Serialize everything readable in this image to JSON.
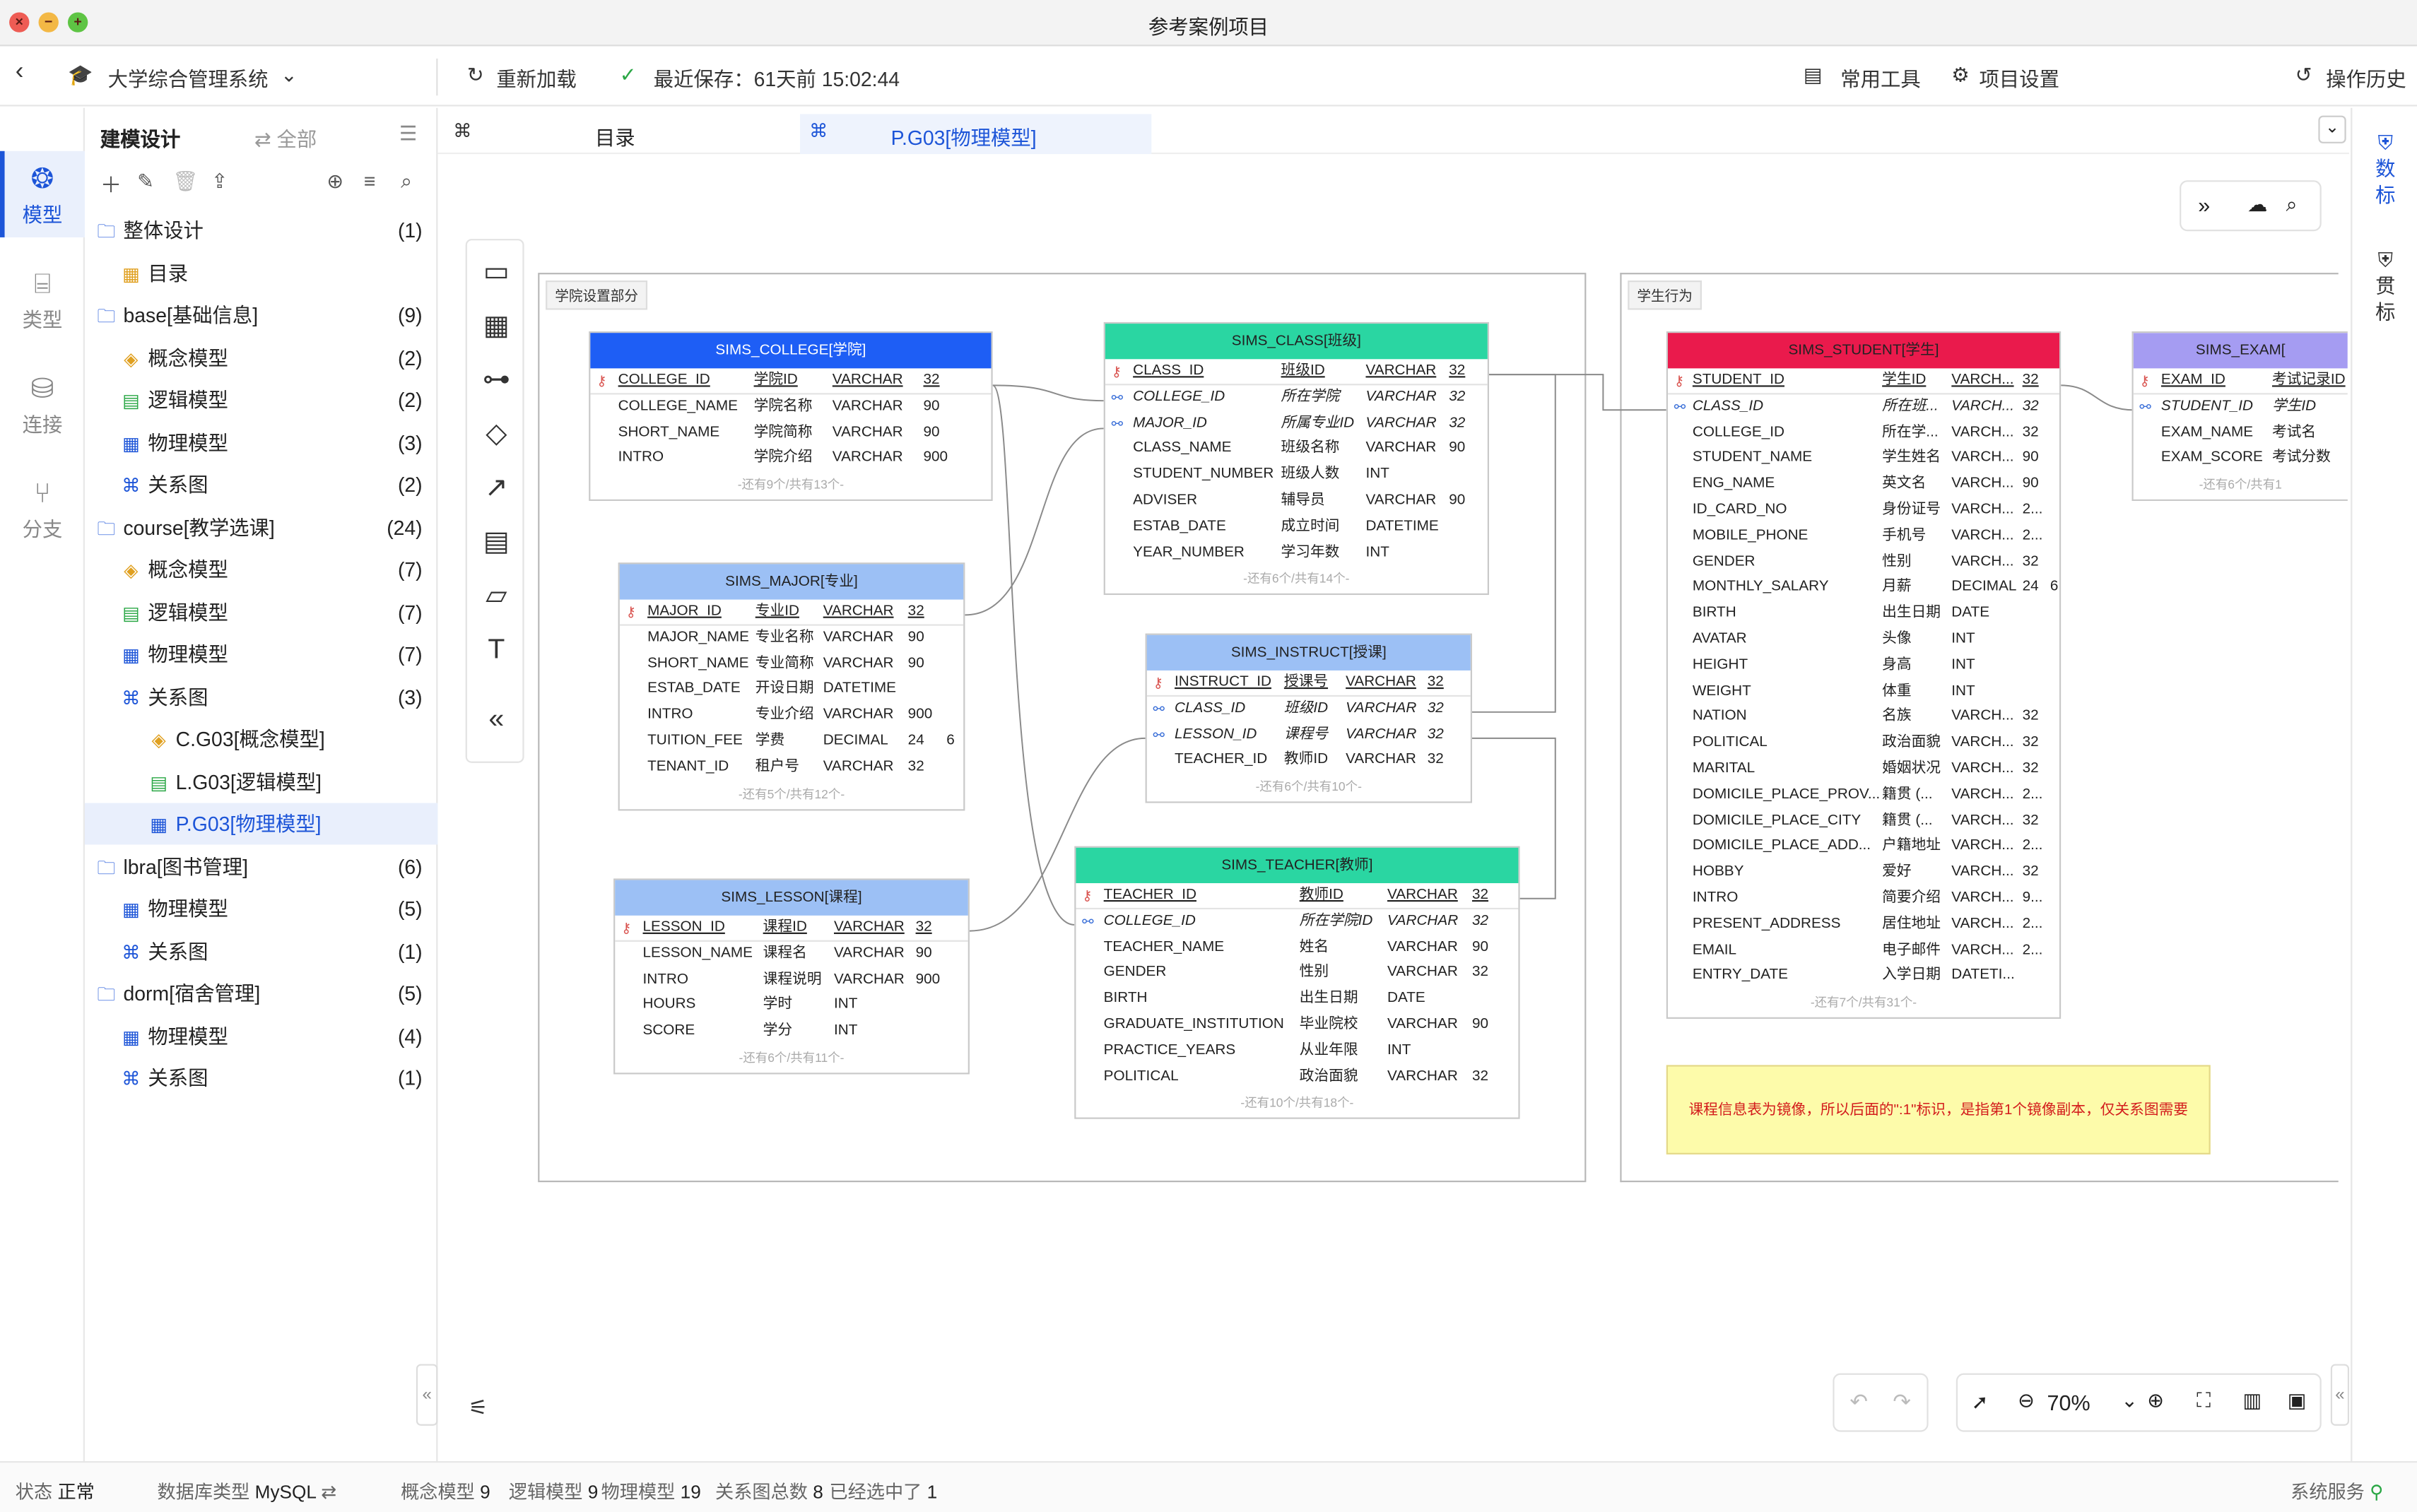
{
  "window": {
    "title": "参考案例项目"
  },
  "toolbar": {
    "project": "大学综合管理系统",
    "reload": "重新加载",
    "last_saved": "最近保存：61天前 15:02:44",
    "tools": "常用工具",
    "settings": "项目设置",
    "history": "操作历史"
  },
  "rail": [
    {
      "label": "模型",
      "icon": "model-icon"
    },
    {
      "label": "类型",
      "icon": "type-icon"
    },
    {
      "label": "连接",
      "icon": "connection-icon"
    },
    {
      "label": "分支",
      "icon": "branch-icon"
    }
  ],
  "tree_header": {
    "title": "建模设计",
    "filter": "全部"
  },
  "tree": [
    {
      "label": "整体设计",
      "count": "(1)",
      "level": 0,
      "icon": "folder-icon"
    },
    {
      "label": "目录",
      "count": "",
      "level": 1,
      "icon": "catalog-icon"
    },
    {
      "label": "base[基础信息]",
      "count": "(9)",
      "level": 0,
      "icon": "folder-icon"
    },
    {
      "label": "概念模型",
      "count": "(2)",
      "level": 1,
      "icon": "concept-model-icon"
    },
    {
      "label": "逻辑模型",
      "count": "(2)",
      "level": 1,
      "icon": "logic-model-icon"
    },
    {
      "label": "物理模型",
      "count": "(3)",
      "level": 1,
      "icon": "physical-model-icon"
    },
    {
      "label": "关系图",
      "count": "(2)",
      "level": 1,
      "icon": "diagram-icon"
    },
    {
      "label": "course[教学选课]",
      "count": "(24)",
      "level": 0,
      "icon": "folder-icon"
    },
    {
      "label": "概念模型",
      "count": "(7)",
      "level": 1,
      "icon": "concept-model-icon"
    },
    {
      "label": "逻辑模型",
      "count": "(7)",
      "level": 1,
      "icon": "logic-model-icon"
    },
    {
      "label": "物理模型",
      "count": "(7)",
      "level": 1,
      "icon": "physical-model-icon"
    },
    {
      "label": "关系图",
      "count": "(3)",
      "level": 1,
      "icon": "diagram-icon"
    },
    {
      "label": "C.G03[概念模型]",
      "count": "",
      "level": 2,
      "icon": "concept-model-icon"
    },
    {
      "label": "L.G03[逻辑模型]",
      "count": "",
      "level": 2,
      "icon": "logic-model-icon"
    },
    {
      "label": "P.G03[物理模型]",
      "count": "",
      "level": 2,
      "icon": "physical-model-icon",
      "selected": true
    },
    {
      "label": "lbra[图书管理]",
      "count": "(6)",
      "level": 0,
      "icon": "folder-icon"
    },
    {
      "label": "物理模型",
      "count": "(5)",
      "level": 1,
      "icon": "physical-model-icon"
    },
    {
      "label": "关系图",
      "count": "(1)",
      "level": 1,
      "icon": "diagram-icon"
    },
    {
      "label": "dorm[宿舍管理]",
      "count": "(5)",
      "level": 0,
      "icon": "folder-icon"
    },
    {
      "label": "物理模型",
      "count": "(4)",
      "level": 1,
      "icon": "physical-model-icon"
    },
    {
      "label": "关系图",
      "count": "(1)",
      "level": 1,
      "icon": "diagram-icon"
    }
  ],
  "tabs": [
    {
      "label": "目录"
    },
    {
      "label": "P.G03[物理模型]",
      "active": true
    }
  ],
  "groups": [
    {
      "title": "学院设置部分"
    },
    {
      "title": "学生行为"
    }
  ],
  "tables": [
    {
      "name": "SIMS_COLLEGE[学院]",
      "color": "#1e5ef5",
      "textColor": "#ffffff",
      "rows": [
        [
          "COLLEGE_ID",
          "学院ID",
          "VARCHAR",
          "32",
          "",
          "pk"
        ],
        [
          "COLLEGE_NAME",
          "学院名称",
          "VARCHAR",
          "90",
          "",
          ""
        ],
        [
          "SHORT_NAME",
          "学院简称",
          "VARCHAR",
          "90",
          "",
          ""
        ],
        [
          "INTRO",
          "学院介绍",
          "VARCHAR",
          "900",
          "",
          ""
        ]
      ],
      "more": "-还有9个/共有13个-"
    },
    {
      "name": "SIMS_CLASS[班级]",
      "color": "#2ad6a2",
      "textColor": "#222222",
      "rows": [
        [
          "CLASS_ID",
          "班级ID",
          "VARCHAR",
          "32",
          "",
          "pk"
        ],
        [
          "COLLEGE_ID",
          "所在学院",
          "VARCHAR",
          "32",
          "",
          "fk"
        ],
        [
          "MAJOR_ID",
          "所属专业ID",
          "VARCHAR",
          "32",
          "",
          "fk"
        ],
        [
          "CLASS_NAME",
          "班级名称",
          "VARCHAR",
          "90",
          "",
          ""
        ],
        [
          "STUDENT_NUMBER",
          "班级人数",
          "INT",
          "",
          "",
          ""
        ],
        [
          "ADVISER",
          "辅导员",
          "VARCHAR",
          "90",
          "",
          ""
        ],
        [
          "ESTAB_DATE",
          "成立时间",
          "DATETIME",
          "",
          "",
          ""
        ],
        [
          "YEAR_NUMBER",
          "学习年数",
          "INT",
          "",
          "",
          ""
        ]
      ],
      "more": "-还有6个/共有14个-"
    },
    {
      "name": "SIMS_MAJOR[专业]",
      "color": "#9cc0f5",
      "textColor": "#222222",
      "rows": [
        [
          "MAJOR_ID",
          "专业ID",
          "VARCHAR",
          "32",
          "",
          "pk"
        ],
        [
          "MAJOR_NAME",
          "专业名称",
          "VARCHAR",
          "90",
          "",
          ""
        ],
        [
          "SHORT_NAME",
          "专业简称",
          "VARCHAR",
          "90",
          "",
          ""
        ],
        [
          "ESTAB_DATE",
          "开设日期",
          "DATETIME",
          "",
          "",
          ""
        ],
        [
          "INTRO",
          "专业介绍",
          "VARCHAR",
          "900",
          "",
          ""
        ],
        [
          "TUITION_FEE",
          "学费",
          "DECIMAL",
          "24",
          "6",
          ""
        ],
        [
          "TENANT_ID",
          "租户号",
          "VARCHAR",
          "32",
          "",
          ""
        ]
      ],
      "more": "-还有5个/共有12个-"
    },
    {
      "name": "SIMS_INSTRUCT[授课]",
      "color": "#9cc0f5",
      "textColor": "#222222",
      "rows": [
        [
          "INSTRUCT_ID",
          "授课号",
          "VARCHAR",
          "32",
          "",
          "pk"
        ],
        [
          "CLASS_ID",
          "班级ID",
          "VARCHAR",
          "32",
          "",
          "fk"
        ],
        [
          "LESSON_ID",
          "课程号",
          "VARCHAR",
          "32",
          "",
          "fk"
        ],
        [
          "TEACHER_ID",
          "教师ID",
          "VARCHAR",
          "32",
          "",
          ""
        ]
      ],
      "more": "-还有6个/共有10个-"
    },
    {
      "name": "SIMS_LESSON[课程]",
      "color": "#9cc0f5",
      "textColor": "#222222",
      "rows": [
        [
          "LESSON_ID",
          "课程ID",
          "VARCHAR",
          "32",
          "",
          "pk"
        ],
        [
          "LESSON_NAME",
          "课程名",
          "VARCHAR",
          "90",
          "",
          ""
        ],
        [
          "INTRO",
          "课程说明",
          "VARCHAR",
          "900",
          "",
          ""
        ],
        [
          "HOURS",
          "学时",
          "INT",
          "",
          "",
          ""
        ],
        [
          "SCORE",
          "学分",
          "INT",
          "",
          "",
          ""
        ]
      ],
      "more": "-还有6个/共有11个-"
    },
    {
      "name": "SIMS_TEACHER[教师]",
      "color": "#2ad6a2",
      "textColor": "#222222",
      "rows": [
        [
          "TEACHER_ID",
          "教师ID",
          "VARCHAR",
          "32",
          "",
          "pk"
        ],
        [
          "COLLEGE_ID",
          "所在学院ID",
          "VARCHAR",
          "32",
          "",
          "fk"
        ],
        [
          "TEACHER_NAME",
          "姓名",
          "VARCHAR",
          "90",
          "",
          ""
        ],
        [
          "GENDER",
          "性别",
          "VARCHAR",
          "32",
          "",
          ""
        ],
        [
          "BIRTH",
          "出生日期",
          "DATE",
          "",
          "",
          ""
        ],
        [
          "GRADUATE_INSTITUTION",
          "毕业院校",
          "VARCHAR",
          "90",
          "",
          ""
        ],
        [
          "PRACTICE_YEARS",
          "从业年限",
          "INT",
          "",
          "",
          ""
        ],
        [
          "POLITICAL",
          "政治面貌",
          "VARCHAR",
          "32",
          "",
          ""
        ]
      ],
      "more": "-还有10个/共有18个-"
    },
    {
      "name": "SIMS_STUDENT[学生]",
      "color": "#ea1a4c",
      "textColor": "#222222",
      "rows": [
        [
          "STUDENT_ID",
          "学生ID",
          "VARCH...",
          "32",
          "",
          "pk"
        ],
        [
          "CLASS_ID",
          "所在班...",
          "VARCH...",
          "32",
          "",
          "fk"
        ],
        [
          "COLLEGE_ID",
          "所在学...",
          "VARCH...",
          "32",
          "",
          ""
        ],
        [
          "STUDENT_NAME",
          "学生姓名",
          "VARCH...",
          "90",
          "",
          ""
        ],
        [
          "ENG_NAME",
          "英文名",
          "VARCH...",
          "90",
          "",
          ""
        ],
        [
          "ID_CARD_NO",
          "身份证号",
          "VARCH...",
          "2...",
          "",
          ""
        ],
        [
          "MOBILE_PHONE",
          "手机号",
          "VARCH...",
          "2...",
          "",
          ""
        ],
        [
          "GENDER",
          "性别",
          "VARCH...",
          "32",
          "",
          ""
        ],
        [
          "MONTHLY_SALARY",
          "月薪",
          "DECIMAL",
          "24",
          "6",
          ""
        ],
        [
          "BIRTH",
          "出生日期",
          "DATE",
          "",
          "",
          ""
        ],
        [
          "AVATAR",
          "头像",
          "INT",
          "",
          "",
          ""
        ],
        [
          "HEIGHT",
          "身高",
          "INT",
          "",
          "",
          ""
        ],
        [
          "WEIGHT",
          "体重",
          "INT",
          "",
          "",
          ""
        ],
        [
          "NATION",
          "名族",
          "VARCH...",
          "32",
          "",
          ""
        ],
        [
          "POLITICAL",
          "政治面貌",
          "VARCH...",
          "32",
          "",
          ""
        ],
        [
          "MARITAL",
          "婚姻状况",
          "VARCH...",
          "32",
          "",
          ""
        ],
        [
          "DOMICILE_PLACE_PROV...",
          "籍贯 (...",
          "VARCH...",
          "2...",
          "",
          ""
        ],
        [
          "DOMICILE_PLACE_CITY",
          "籍贯 (...",
          "VARCH...",
          "32",
          "",
          ""
        ],
        [
          "DOMICILE_PLACE_ADD...",
          "户籍地址",
          "VARCH...",
          "2...",
          "",
          ""
        ],
        [
          "HOBBY",
          "爱好",
          "VARCH...",
          "32",
          "",
          ""
        ],
        [
          "INTRO",
          "简要介绍",
          "VARCH...",
          "9...",
          "",
          ""
        ],
        [
          "PRESENT_ADDRESS",
          "居住地址",
          "VARCH...",
          "2...",
          "",
          ""
        ],
        [
          "EMAIL",
          "电子邮件",
          "VARCH...",
          "2...",
          "",
          ""
        ],
        [
          "ENTRY_DATE",
          "入学日期",
          "DATETI...",
          "",
          "",
          ""
        ]
      ],
      "more": "-还有7个/共有31个-"
    },
    {
      "name": "SIMS_EXAM[",
      "color": "#a59cf2",
      "textColor": "#222222",
      "rows": [
        [
          "EXAM_ID",
          "考试记录ID",
          "",
          "",
          "",
          "pk"
        ],
        [
          "STUDENT_ID",
          "学生ID",
          "",
          "",
          "",
          "fk"
        ],
        [
          "EXAM_NAME",
          "考试名",
          "",
          "",
          "",
          ""
        ],
        [
          "EXAM_SCORE",
          "考试分数",
          "",
          "",
          "",
          ""
        ]
      ],
      "more": "-还有6个/共有1"
    }
  ],
  "note": "课程信息表为镜像，所以后面的\":1\"标识，是指第1个镜像副本，仅关系图需要",
  "right_rail": [
    {
      "label": "数标",
      "icon": "data-standard-icon"
    },
    {
      "label": "贯标",
      "icon": "standard-apply-icon"
    }
  ],
  "zoom": "70%",
  "status": {
    "state_label": "状态",
    "state": "正常",
    "db_label": "数据库类型",
    "db": "MySQL",
    "concept_label": "概念模型",
    "concept": "9",
    "logic_label": "逻辑模型",
    "logic": "9",
    "physical_label": "物理模型",
    "physical": "19",
    "diagram_label": "关系图总数",
    "diagram": "8",
    "selected_label": "已经选中了",
    "selected": "1",
    "service": "系统服务"
  }
}
